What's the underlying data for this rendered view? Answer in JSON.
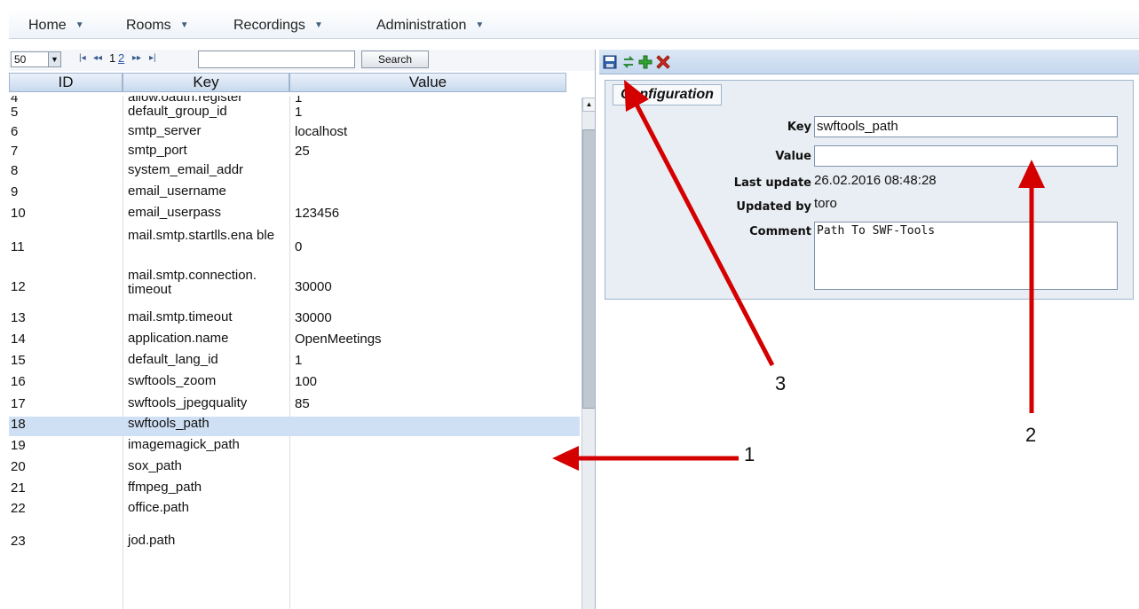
{
  "menu": {
    "items": [
      {
        "label": "Home"
      },
      {
        "label": "Rooms"
      },
      {
        "label": "Recordings"
      },
      {
        "label": "Administration"
      }
    ]
  },
  "pager": {
    "page_size": "50",
    "first_icon": "first-page-icon",
    "prev_icon": "prev-page-icon",
    "pages": [
      "1",
      "2"
    ],
    "current_page": "1",
    "next_icon": "next-page-icon",
    "last_icon": "last-page-icon",
    "search_value": "",
    "search_label": "Search"
  },
  "grid": {
    "columns": [
      "ID",
      "Key",
      "Value"
    ],
    "rows": [
      {
        "id": "4",
        "key": "allow.oauth.register",
        "value": "1"
      },
      {
        "id": "5",
        "key": "default_group_id",
        "value": "1"
      },
      {
        "id": "6",
        "key": "smtp_server",
        "value": "localhost"
      },
      {
        "id": "7",
        "key": "smtp_port",
        "value": "25"
      },
      {
        "id": "8",
        "key": "system_email_addr",
        "value": ""
      },
      {
        "id": "9",
        "key": "email_username",
        "value": ""
      },
      {
        "id": "10",
        "key": "email_userpass",
        "value": "123456"
      },
      {
        "id": "11",
        "key": "mail.smtp.startlls.ena ble",
        "value": "0"
      },
      {
        "id": "12",
        "key": "mail.smtp.connection. timeout",
        "value": "30000"
      },
      {
        "id": "13",
        "key": "mail.smtp.timeout",
        "value": "30000"
      },
      {
        "id": "14",
        "key": "application.name",
        "value": "OpenMeetings"
      },
      {
        "id": "15",
        "key": "default_lang_id",
        "value": "1"
      },
      {
        "id": "16",
        "key": "swftools_zoom",
        "value": "100"
      },
      {
        "id": "17",
        "key": "swftools_jpegquality",
        "value": "85"
      },
      {
        "id": "18",
        "key": "swftools_path",
        "value": ""
      },
      {
        "id": "19",
        "key": "imagemagick_path",
        "value": ""
      },
      {
        "id": "20",
        "key": "sox_path",
        "value": ""
      },
      {
        "id": "21",
        "key": "ffmpeg_path",
        "value": ""
      },
      {
        "id": "22",
        "key": "office.path",
        "value": ""
      },
      {
        "id": "23",
        "key": "jod.path",
        "value": ""
      }
    ],
    "selected_id": "18"
  },
  "toolbar": {
    "icons": [
      "save-icon",
      "refresh-icon",
      "add-icon",
      "delete-icon"
    ]
  },
  "form": {
    "title": "Configuration",
    "key_label": "Key",
    "key_value": "swftools_path",
    "value_label": "Value",
    "value_value": "",
    "last_update_label": "Last update",
    "last_update_value": "26.02.2016 08:48:28",
    "updated_by_label": "Updated by",
    "updated_by_value": "toro",
    "comment_label": "Comment",
    "comment_value": "Path To SWF-Tools"
  },
  "annotations": {
    "labels": [
      "1",
      "2",
      "3"
    ],
    "arrow_color": "#d40000"
  }
}
